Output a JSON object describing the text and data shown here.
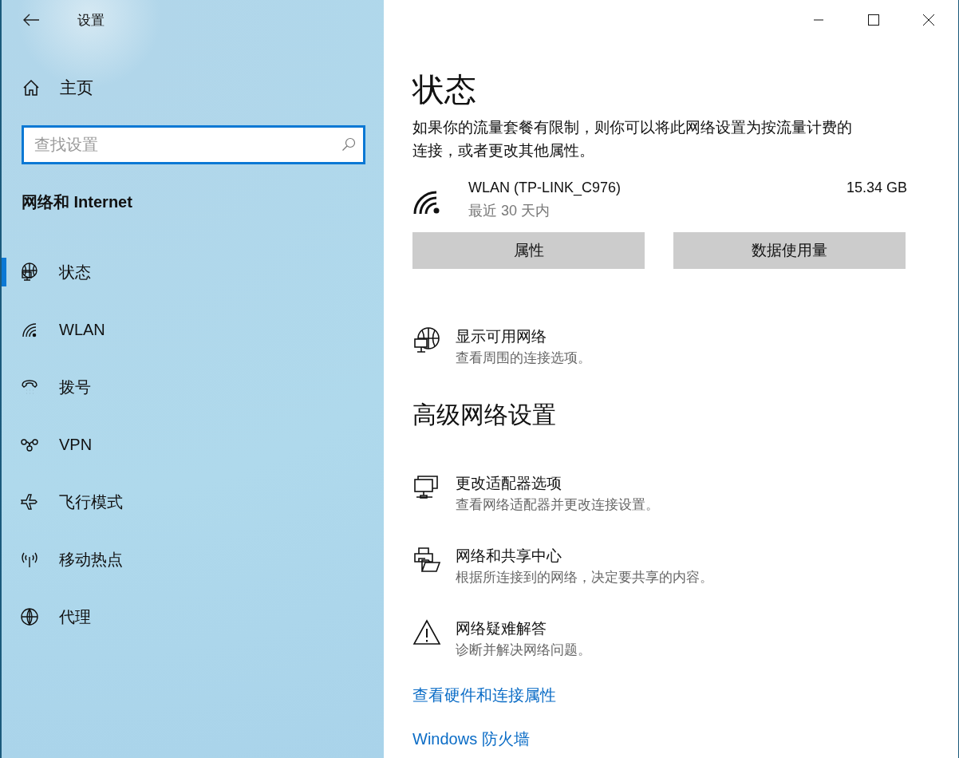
{
  "window": {
    "title": "设置"
  },
  "home": {
    "label": "主页"
  },
  "search": {
    "placeholder": "查找设置"
  },
  "section": "网络和 Internet",
  "nav": [
    {
      "label": "状态",
      "kind": "status",
      "selected": true
    },
    {
      "label": "WLAN",
      "kind": "wifi",
      "selected": false
    },
    {
      "label": "拨号",
      "kind": "phone",
      "selected": false
    },
    {
      "label": "VPN",
      "kind": "vpn",
      "selected": false
    },
    {
      "label": "飞行模式",
      "kind": "airplane",
      "selected": false
    },
    {
      "label": "移动热点",
      "kind": "hotspot",
      "selected": false
    },
    {
      "label": "代理",
      "kind": "globe",
      "selected": false
    }
  ],
  "page": {
    "title": "状态",
    "description": "如果你的流量套餐有限制，则你可以将此网络设置为按流量计费的连接，或者更改其他属性。",
    "connection": {
      "name": "WLAN (TP-LINK_C976)",
      "period": "最近 30 天内",
      "usage": "15.34 GB"
    },
    "buttons": [
      "属性",
      "数据使用量"
    ],
    "network_actions": [
      {
        "title": "显示可用网络",
        "subtitle": "查看周围的连接选项。",
        "kind": "status"
      }
    ],
    "advanced": {
      "heading": "高级网络设置",
      "actions": [
        {
          "title": "更改适配器选项",
          "subtitle": "查看网络适配器并更改连接设置。",
          "kind": "adapter"
        },
        {
          "title": "网络和共享中心",
          "subtitle": "根据所连接到的网络，决定要共享的内容。",
          "kind": "sharing"
        },
        {
          "title": "网络疑难解答",
          "subtitle": "诊断并解决网络问题。",
          "kind": "warning"
        }
      ]
    },
    "links": [
      "查看硬件和连接属性",
      "Windows 防火墙"
    ]
  }
}
